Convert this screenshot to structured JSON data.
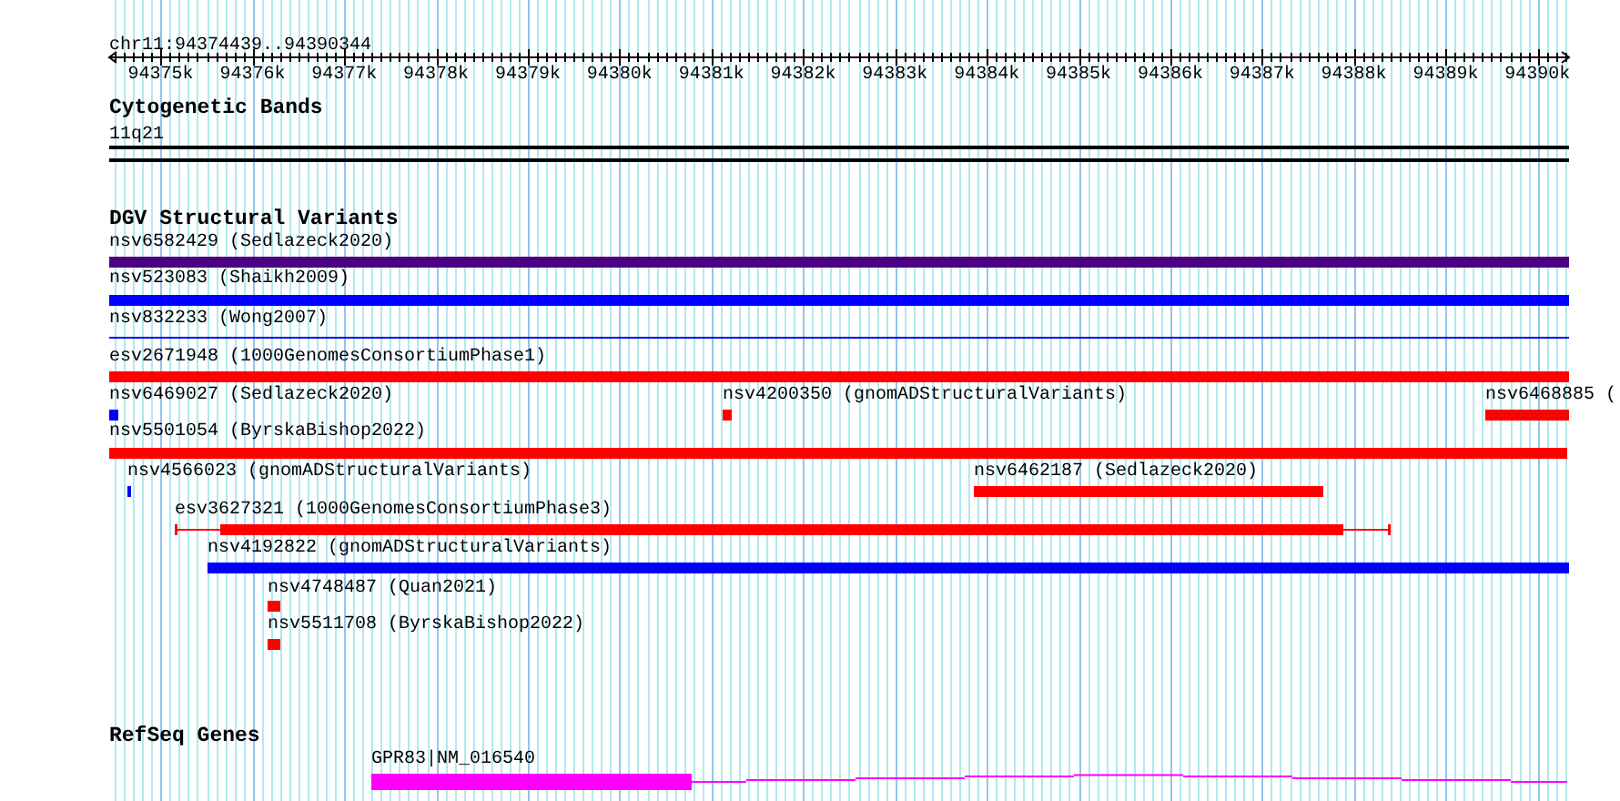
{
  "location": "chr11:94374439..94390344",
  "ruler": {
    "ticks": [
      "94375k",
      "94376k",
      "94377k",
      "94378k",
      "94379k",
      "94380k",
      "94381k",
      "94382k",
      "94383k",
      "94384k",
      "94385k",
      "94386k",
      "94387k",
      "94388k",
      "94389k",
      "94390k"
    ]
  },
  "tracks": [
    {
      "title": "Cytogenetic Bands",
      "kind": "bands",
      "features": [
        {
          "label": "11q21"
        }
      ]
    },
    {
      "title": "DGV Structural Variants",
      "kind": "variants",
      "features": [
        {
          "label": "nsv6582429 (Sedlazeck2020)",
          "color": "#4b0082",
          "kind": "bar"
        },
        {
          "label": "nsv523083 (Shaikh2009)",
          "color": "#0000ff",
          "kind": "bar"
        },
        {
          "label": "nsv832233 (Wong2007)",
          "color": "#0000ff",
          "kind": "line"
        },
        {
          "label": "esv2671948 (1000GenomesConsortiumPhase1)",
          "color": "#ff0000",
          "kind": "bar"
        },
        {
          "label": "nsv6469027 (Sedlazeck2020)",
          "color": "#0000ff",
          "kind": "bar"
        },
        {
          "label": "nsv4200350 (gnomADStructuralVariants)",
          "color": "#ff0000",
          "kind": "bar"
        },
        {
          "label": "nsv6468885 (",
          "color": "#ff0000",
          "kind": "bar"
        },
        {
          "label": "nsv5501054 (ByrskaBishop2022)",
          "color": "#ff0000",
          "kind": "bar"
        },
        {
          "label": "nsv4566023 (gnomADStructuralVariants)",
          "color": "#0000ff",
          "kind": "bar"
        },
        {
          "label": "nsv6462187 (Sedlazeck2020)",
          "color": "#ff0000",
          "kind": "bar"
        },
        {
          "label": "esv3627321 (1000GenomesConsortiumPhase3)",
          "color": "#ff0000",
          "kind": "whisker"
        },
        {
          "label": "nsv4192822 (gnomADStructuralVariants)",
          "color": "#0000ff",
          "kind": "bar"
        },
        {
          "label": "nsv4748487 (Quan2021)",
          "color": "#ff0000",
          "kind": "bar"
        },
        {
          "label": "nsv5511708 (ByrskaBishop2022)",
          "color": "#ff0000",
          "kind": "bar"
        }
      ]
    },
    {
      "title": "RefSeq Genes",
      "kind": "genes",
      "features": [
        {
          "label": "GPR83|NM_016540"
        }
      ]
    }
  ]
}
